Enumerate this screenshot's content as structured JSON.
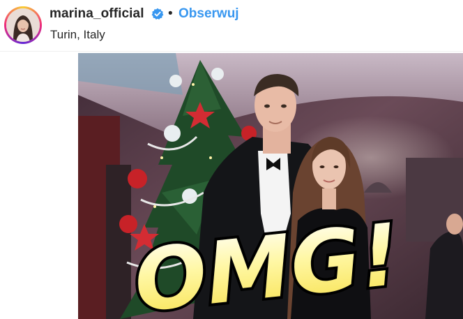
{
  "header": {
    "username": "marina_official",
    "separator": "•",
    "follow_label": "Obserwuj",
    "location": "Turin, Italy"
  },
  "icons": {
    "verified": "verified-badge-icon",
    "avatar": "profile-avatar"
  },
  "photo": {
    "overlay_text": "OMG!"
  },
  "colors": {
    "follow_blue": "#3897f0",
    "verified_blue": "#3897f0",
    "text_dark": "#262626",
    "omg_fill": "#fff27a",
    "omg_outline": "#000000"
  }
}
